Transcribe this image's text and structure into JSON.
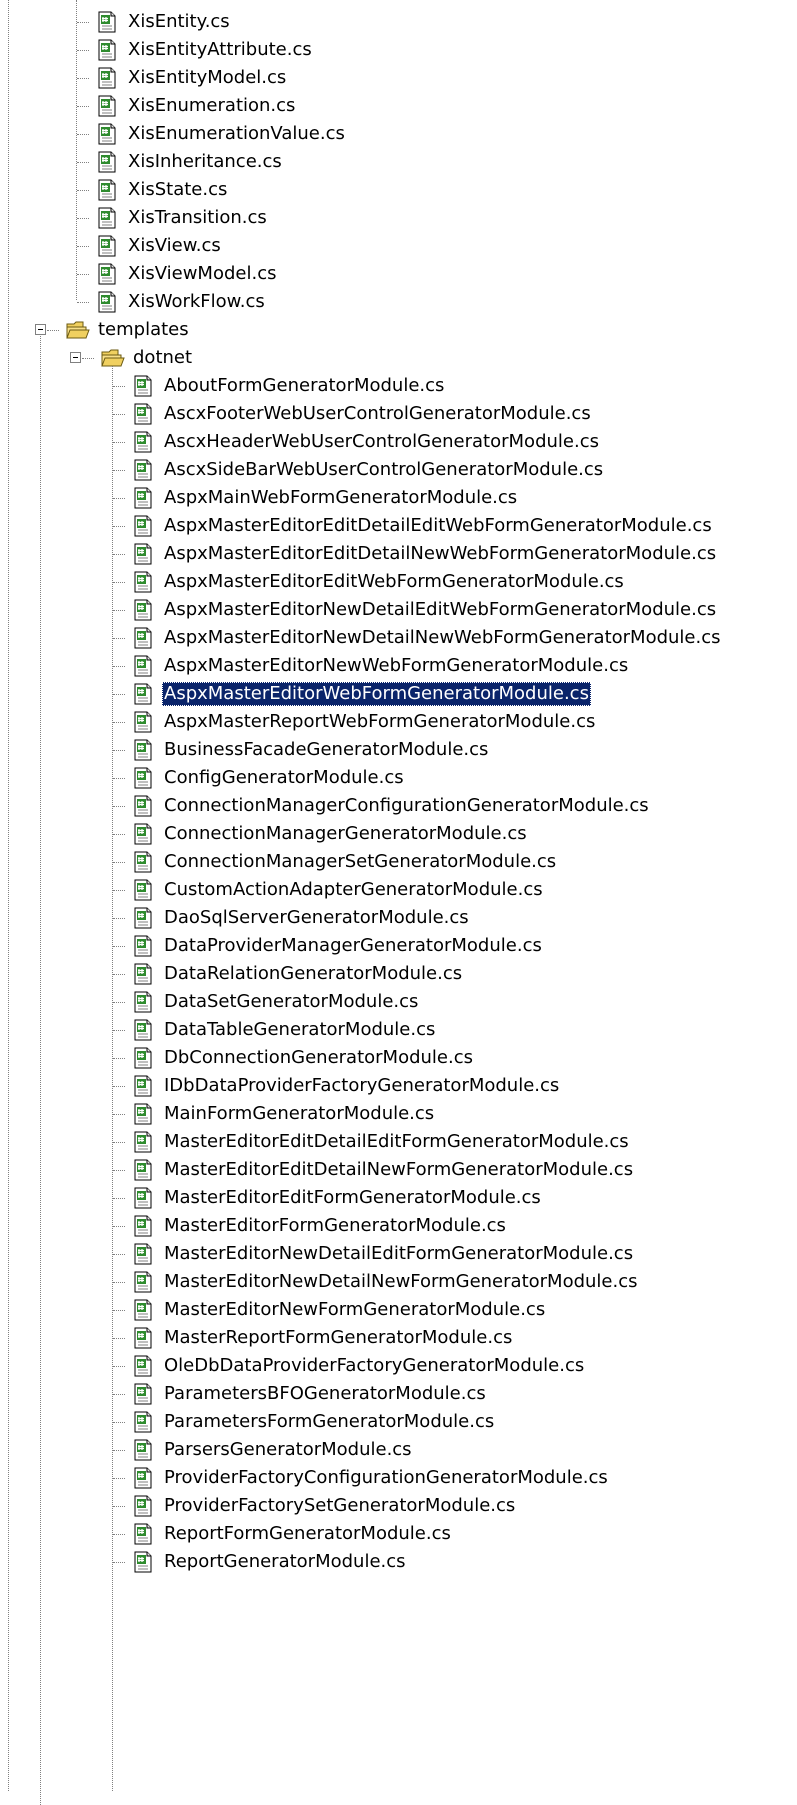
{
  "tree": {
    "upper_files": [
      "XisEntity.cs",
      "XisEntityAttribute.cs",
      "XisEntityModel.cs",
      "XisEnumeration.cs",
      "XisEnumerationValue.cs",
      "XisInheritance.cs",
      "XisState.cs",
      "XisTransition.cs",
      "XisView.cs",
      "XisViewModel.cs",
      "XisWorkFlow.cs"
    ],
    "folders": {
      "templates": "templates",
      "dotnet": "dotnet"
    },
    "dotnet_files": [
      "AboutFormGeneratorModule.cs",
      "AscxFooterWebUserControlGeneratorModule.cs",
      "AscxHeaderWebUserControlGeneratorModule.cs",
      "AscxSideBarWebUserControlGeneratorModule.cs",
      "AspxMainWebFormGeneratorModule.cs",
      "AspxMasterEditorEditDetailEditWebFormGeneratorModule.cs",
      "AspxMasterEditorEditDetailNewWebFormGeneratorModule.cs",
      "AspxMasterEditorEditWebFormGeneratorModule.cs",
      "AspxMasterEditorNewDetailEditWebFormGeneratorModule.cs",
      "AspxMasterEditorNewDetailNewWebFormGeneratorModule.cs",
      "AspxMasterEditorNewWebFormGeneratorModule.cs",
      "AspxMasterEditorWebFormGeneratorModule.cs",
      "AspxMasterReportWebFormGeneratorModule.cs",
      "BusinessFacadeGeneratorModule.cs",
      "ConfigGeneratorModule.cs",
      "ConnectionManagerConfigurationGeneratorModule.cs",
      "ConnectionManagerGeneratorModule.cs",
      "ConnectionManagerSetGeneratorModule.cs",
      "CustomActionAdapterGeneratorModule.cs",
      "DaoSqlServerGeneratorModule.cs",
      "DataProviderManagerGeneratorModule.cs",
      "DataRelationGeneratorModule.cs",
      "DataSetGeneratorModule.cs",
      "DataTableGeneratorModule.cs",
      "DbConnectionGeneratorModule.cs",
      "IDbDataProviderFactoryGeneratorModule.cs",
      "MainFormGeneratorModule.cs",
      "MasterEditorEditDetailEditFormGeneratorModule.cs",
      "MasterEditorEditDetailNewFormGeneratorModule.cs",
      "MasterEditorEditFormGeneratorModule.cs",
      "MasterEditorFormGeneratorModule.cs",
      "MasterEditorNewDetailEditFormGeneratorModule.cs",
      "MasterEditorNewDetailNewFormGeneratorModule.cs",
      "MasterEditorNewFormGeneratorModule.cs",
      "MasterReportFormGeneratorModule.cs",
      "OleDbDataProviderFactoryGeneratorModule.cs",
      "ParametersBFOGeneratorModule.cs",
      "ParametersFormGeneratorModule.cs",
      "ParsersGeneratorModule.cs",
      "ProviderFactoryConfigurationGeneratorModule.cs",
      "ProviderFactorySetGeneratorModule.cs",
      "ReportFormGeneratorModule.cs",
      "ReportGeneratorModule.cs"
    ],
    "selected_file": "AspxMasterEditorWebFormGeneratorModule.cs",
    "icons": {
      "file": "csharp-file-icon",
      "folder": "open-folder-icon",
      "expander": "collapse-minus-icon"
    },
    "colors": {
      "selection_bg": "#0a246a",
      "selection_text": "#ffffff",
      "folder_yellow": "#f0d060",
      "file_green": "#2e8b2e"
    }
  }
}
